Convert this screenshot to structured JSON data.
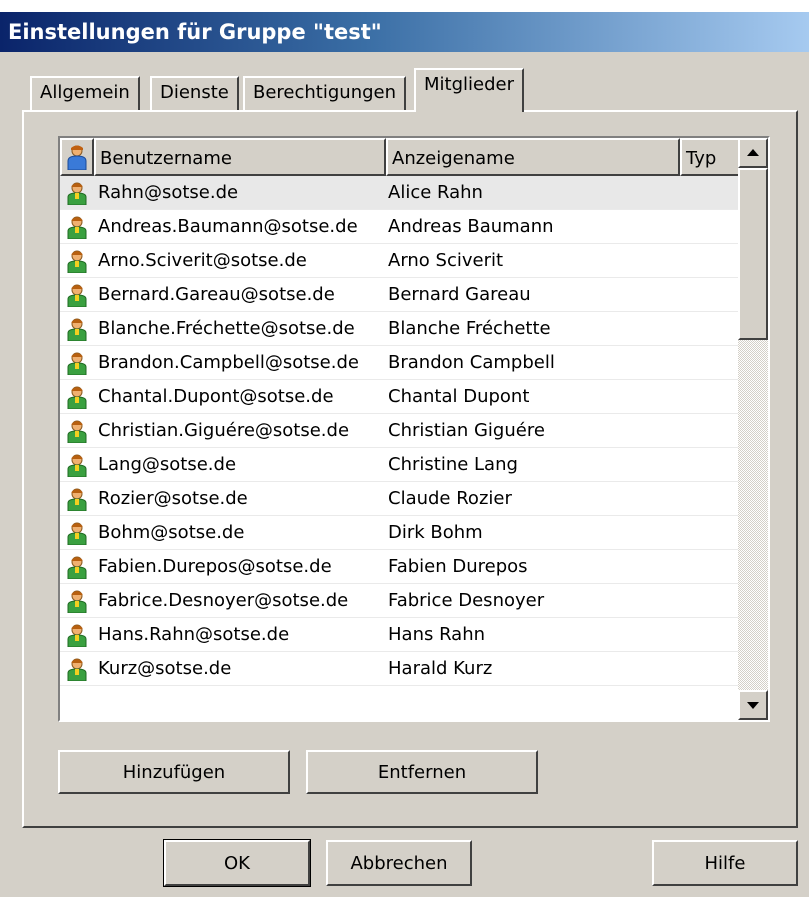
{
  "window": {
    "title": "Einstellungen für Gruppe \"test\""
  },
  "tabs": [
    {
      "label": "Allgemein"
    },
    {
      "label": "Dienste"
    },
    {
      "label": "Berechtigungen"
    },
    {
      "label": "Mitglieder",
      "active": true
    }
  ],
  "list": {
    "columns": {
      "user": "Benutzername",
      "display": "Anzeigename",
      "type": "Typ"
    },
    "rows": [
      {
        "user": "Rahn@sotse.de",
        "display": "Alice Rahn"
      },
      {
        "user": "Andreas.Baumann@sotse.de",
        "display": "Andreas Baumann"
      },
      {
        "user": "Arno.Sciverit@sotse.de",
        "display": "Arno Sciverit"
      },
      {
        "user": "Bernard.Gareau@sotse.de",
        "display": "Bernard Gareau"
      },
      {
        "user": "Blanche.Fréchette@sotse.de",
        "display": "Blanche Fréchette"
      },
      {
        "user": "Brandon.Campbell@sotse.de",
        "display": "Brandon Campbell"
      },
      {
        "user": "Chantal.Dupont@sotse.de",
        "display": "Chantal Dupont"
      },
      {
        "user": "Christian.Giguére@sotse.de",
        "display": "Christian Giguére"
      },
      {
        "user": "Lang@sotse.de",
        "display": "Christine Lang"
      },
      {
        "user": "Rozier@sotse.de",
        "display": "Claude Rozier"
      },
      {
        "user": "Bohm@sotse.de",
        "display": "Dirk Bohm"
      },
      {
        "user": "Fabien.Durepos@sotse.de",
        "display": "Fabien Durepos"
      },
      {
        "user": "Fabrice.Desnoyer@sotse.de",
        "display": "Fabrice Desnoyer"
      },
      {
        "user": "Hans.Rahn@sotse.de",
        "display": "Hans Rahn"
      },
      {
        "user": "Kurz@sotse.de",
        "display": "Harald Kurz"
      }
    ]
  },
  "buttons": {
    "add": "Hinzufügen",
    "remove": "Entfernen",
    "ok": "OK",
    "cancel": "Abbrechen",
    "help": "Hilfe"
  },
  "colors": {
    "titlebar_start": "#0a246a",
    "titlebar_end": "#a6caf0",
    "face": "#d4d0c8"
  },
  "icons": {
    "user": "user-icon",
    "header": "users-header-icon"
  }
}
